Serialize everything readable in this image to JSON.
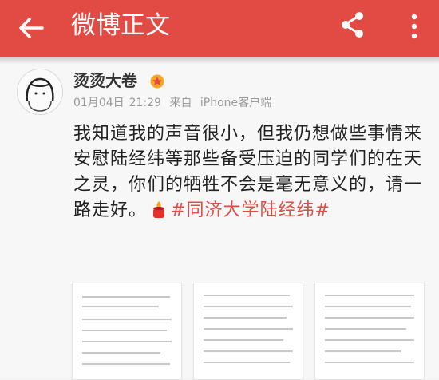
{
  "appbar": {
    "title": "微博正文",
    "bg_color": "#e24b43",
    "icons": [
      "arrow-left-icon",
      "share-icon",
      "more-vertical-icon"
    ]
  },
  "post": {
    "author": "烫烫大卷",
    "date": "01月04日",
    "time": "21:29",
    "from_label": "来自",
    "client": "iPhone客户端",
    "text_main": "我知道我的声音很小，但我仍想做些事情来安慰陆经纬等那些备受压迫的同学们的在天之灵，你们的牺牲不会是毫无意义的，请一路走好。",
    "topic": "#同济大学陆经纬#",
    "topic_color": "#e24b43",
    "inline_icon": "candle-icon",
    "thumbnails": [
      {
        "name": "document-image-1"
      },
      {
        "name": "document-image-2"
      },
      {
        "name": "document-image-3"
      }
    ]
  }
}
